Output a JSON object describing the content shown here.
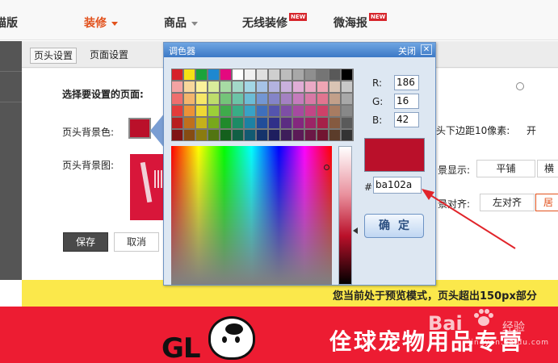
{
  "nav": {
    "left_partial": "描版",
    "items": [
      {
        "label": "装修",
        "active": true,
        "has_caret": true
      },
      {
        "label": "商品",
        "active": false,
        "has_caret": true
      },
      {
        "label": "无线装修",
        "active": false,
        "badge": "NEW"
      },
      {
        "label": "微海报",
        "active": false,
        "badge": "NEW"
      }
    ]
  },
  "panel": {
    "tabs": [
      {
        "label": "页头设置",
        "active": true
      },
      {
        "label": "页面设置",
        "active": false
      }
    ],
    "select_page_label": "选择要设置的页面:",
    "bg_color_label": "页头背景色:",
    "bg_color_value": "#ba102a",
    "bg_image_label": "页头背景图:",
    "bottom_margin_label": "头下边距10像素:",
    "radio_label": "开",
    "display_label": "景显示:",
    "display_options": [
      "平铺",
      "横"
    ],
    "align_label": "景对齐:",
    "align_options": [
      "左对齐",
      "居"
    ],
    "save_label": "保存",
    "cancel_label": "取消"
  },
  "picker": {
    "title": "调色器",
    "close_label": "关闭",
    "close_icon": "close-icon",
    "r_label": "R:",
    "g_label": "G:",
    "b_label": "B:",
    "r_value": "186",
    "g_value": "16",
    "b_value": "42",
    "hash_label": "#:",
    "hex_value": "ba102a",
    "preview_color": "#ba102a",
    "ok_label": "确定",
    "palette": [
      [
        "#d62128",
        "#f6e115",
        "#1aa33b",
        "#1e88d0",
        "#e4097f",
        "#ffffff",
        "#f0f0f0",
        "#e0e0e0",
        "#cfcfcf",
        "#bdbdbd",
        "#a8a8a8",
        "#8f8f8f",
        "#757575",
        "#595959",
        "#000000"
      ],
      [
        "#f4a3a3",
        "#f8d79b",
        "#fbf29b",
        "#d9ec9b",
        "#a7dba4",
        "#a3d9c8",
        "#a3d6e5",
        "#a6c3e6",
        "#b3b3e0",
        "#c9b0dc",
        "#e0add6",
        "#eaa9c5",
        "#f0a5b4",
        "#d9c4b4",
        "#c8c8c8"
      ],
      [
        "#ef6e6e",
        "#f3b56c",
        "#f6e767",
        "#bedd6b",
        "#74c479",
        "#6cc4a7",
        "#6cbcd6",
        "#7396d3",
        "#8484c8",
        "#a481c2",
        "#c57cbc",
        "#d879a6",
        "#e27590",
        "#c2a08a",
        "#a8a8a8"
      ],
      [
        "#e33b3b",
        "#ec9237",
        "#efd834",
        "#9ccf38",
        "#3fab4b",
        "#38ad85",
        "#38a2c6",
        "#3f6fbc",
        "#5454ae",
        "#7e4ea6",
        "#a64aa0",
        "#c24686",
        "#cd4168",
        "#a87c62",
        "#888888"
      ],
      [
        "#b81f1f",
        "#c0701c",
        "#c5b11a",
        "#78a81b",
        "#208a2b",
        "#1c8b65",
        "#1c81a4",
        "#214d99",
        "#303089",
        "#5b2c82",
        "#84277e",
        "#9b2466",
        "#a52048",
        "#855a40",
        "#5a5a5a"
      ],
      [
        "#801414",
        "#864c12",
        "#8a7b10",
        "#527512",
        "#14601d",
        "#125f45",
        "#125a72",
        "#15336b",
        "#1e1e5f",
        "#3e1d5a",
        "#5b1a57",
        "#6b1846",
        "#721531",
        "#5b3c2a",
        "#333333"
      ]
    ]
  },
  "banner": {
    "preview_notice": "您当前处于预览模式，页头超出150px部分"
  },
  "store": {
    "logo_text": "GL",
    "title": "佺球宠物用品专营",
    "watermark": "Bai",
    "watermark_cn": "经验",
    "watermark_sub": "jingyan.baidu.com"
  }
}
